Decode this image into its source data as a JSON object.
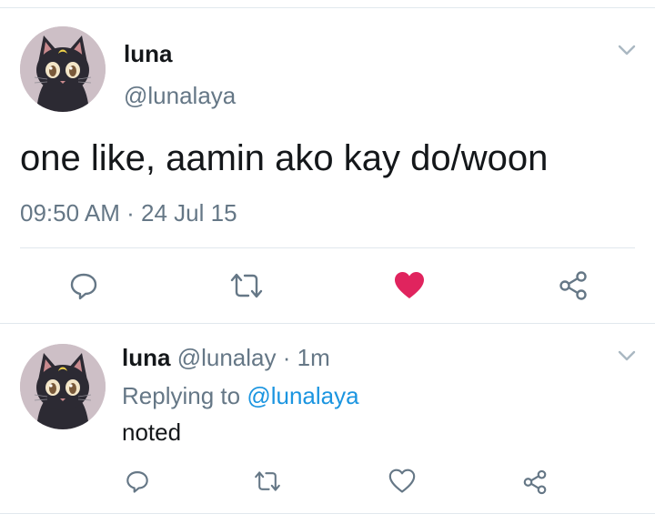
{
  "main_tweet": {
    "name": "luna",
    "handle": "@lunalaya",
    "text": "one like, aamin ako kay do/woon",
    "timestamp": "09:50 AM",
    "separator": "·",
    "date": "24 Jul 15",
    "liked": true,
    "icons": [
      "reply-icon",
      "retweet-icon",
      "heart-filled-icon",
      "share-icon"
    ],
    "colors": {
      "like": "#e0245e",
      "icon": "#657786"
    }
  },
  "reply_tweet": {
    "name": "luna",
    "handle": "@lunalay",
    "separator": "·",
    "age": "1m",
    "replying_prefix": "Replying to",
    "replying_handle": "@lunalaya",
    "text": "noted",
    "liked": false,
    "icons": [
      "reply-icon",
      "retweet-icon",
      "heart-outline-icon",
      "share-icon"
    ],
    "colors": {
      "link": "#1b95e0"
    }
  }
}
